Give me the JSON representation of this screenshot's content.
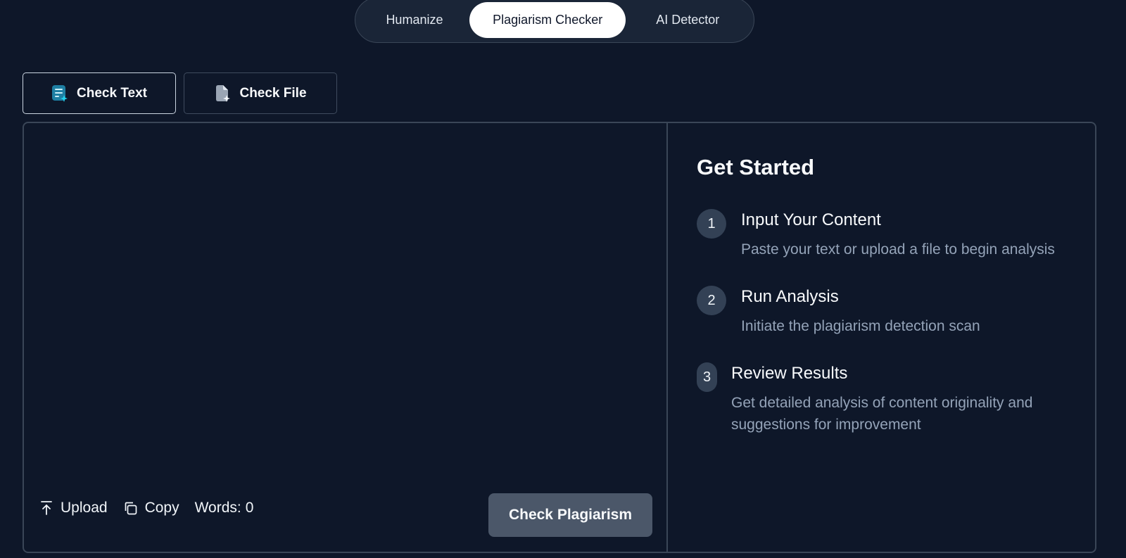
{
  "top_nav": {
    "tabs": [
      {
        "label": "Humanize"
      },
      {
        "label": "Plagiarism Checker",
        "active": true
      },
      {
        "label": "AI Detector"
      }
    ]
  },
  "mode": {
    "check_text_label": "Check Text",
    "check_file_label": "Check File",
    "active": "Check Text"
  },
  "editor": {
    "text": "",
    "upload_label": "Upload",
    "copy_label": "Copy",
    "words_label": "Words:",
    "words_count": "0",
    "submit_label": "Check Plagiarism"
  },
  "guide": {
    "title": "Get Started",
    "steps": [
      {
        "number": "1",
        "title": "Input Your Content",
        "description": "Paste your text or upload a file to begin analysis"
      },
      {
        "number": "2",
        "title": "Run Analysis",
        "description": "Initiate the plagiarism detection scan"
      },
      {
        "number": "3",
        "title": "Review Results",
        "description": "Get detailed analysis of content originality and suggestions for improvement"
      }
    ]
  },
  "colors": {
    "background": "#0e1729",
    "border": "#3a4657",
    "accent": "#22d3ee",
    "button_disabled": "#4b5769",
    "muted_text": "#94a3b8"
  }
}
